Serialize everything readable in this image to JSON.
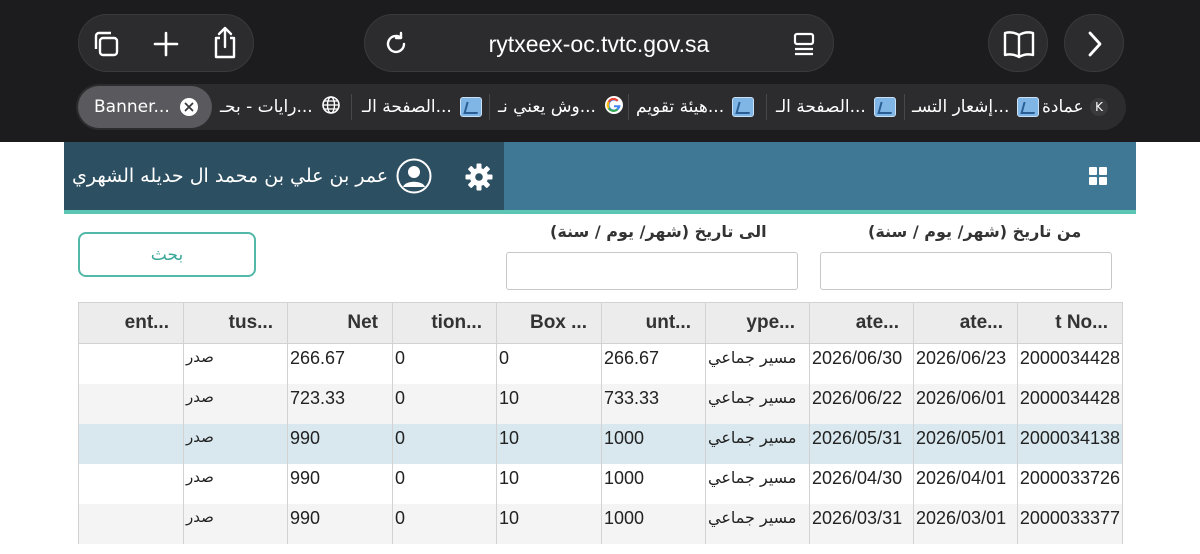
{
  "browser": {
    "url": "rytxeex-oc.tvtc.gov.sa",
    "tabs": [
      {
        "label": "Banner...",
        "active": true,
        "icon": "close-icon"
      },
      {
        "label": "رايات - بحـ...",
        "icon": "globe-icon"
      },
      {
        "label": "الصفحة الـ...",
        "icon": "site-favicon"
      },
      {
        "label": "وش يعني نـ...",
        "icon": "google-icon"
      },
      {
        "label": "هيئة تقويم...",
        "icon": "site-favicon"
      },
      {
        "label": "الصفحة الـ...",
        "icon": "site-favicon"
      },
      {
        "label": "إشعار التسـ...",
        "icon": "site-favicon"
      },
      {
        "label": "عمادة",
        "icon": "site-favicon"
      },
      {
        "label": "K",
        "icon": "letter-avatar"
      }
    ],
    "colors": {
      "chrome": "#1c1c1e",
      "pill": "#2c2c2e"
    }
  },
  "header": {
    "user_name": "عمر بن علي بن محمد ال حديله الشهري",
    "icons": [
      "apps-grid-icon",
      "gear-icon",
      "user-avatar-icon"
    ],
    "colors": {
      "bar": "#3e7894",
      "accent": "#5cc6b4"
    }
  },
  "filters": {
    "from_label": "من تاريخ (شهر/ يوم / سنة)",
    "to_label": "الى تاريخ (شهر/ يوم / سنة)",
    "from_value": "",
    "to_value": "",
    "search_label": "بحث"
  },
  "table": {
    "headers": [
      "...t No",
      "...ate",
      "...ate",
      "...ype",
      "...unt",
      "... Box",
      "...tion",
      "Net",
      "...tus",
      "...ent"
    ],
    "rows": [
      [
        "2000034428",
        "2026/06/23",
        "2026/06/30",
        "مسير جماعي",
        "266.67",
        "0",
        "0",
        "266.67",
        "صدر",
        ""
      ],
      [
        "2000034428",
        "2026/06/01",
        "2026/06/22",
        "مسير جماعي",
        "733.33",
        "10",
        "0",
        "723.33",
        "صدر",
        ""
      ],
      [
        "2000034138",
        "2026/05/01",
        "2026/05/31",
        "مسير جماعي",
        "1000",
        "10",
        "0",
        "990",
        "صدر",
        ""
      ],
      [
        "2000033726",
        "2026/04/01",
        "2026/04/30",
        "مسير جماعي",
        "1000",
        "10",
        "0",
        "990",
        "صدر",
        ""
      ],
      [
        "2000033377",
        "2026/03/01",
        "2026/03/31",
        "مسير جماعي",
        "1000",
        "10",
        "0",
        "990",
        "صدر",
        ""
      ]
    ]
  }
}
